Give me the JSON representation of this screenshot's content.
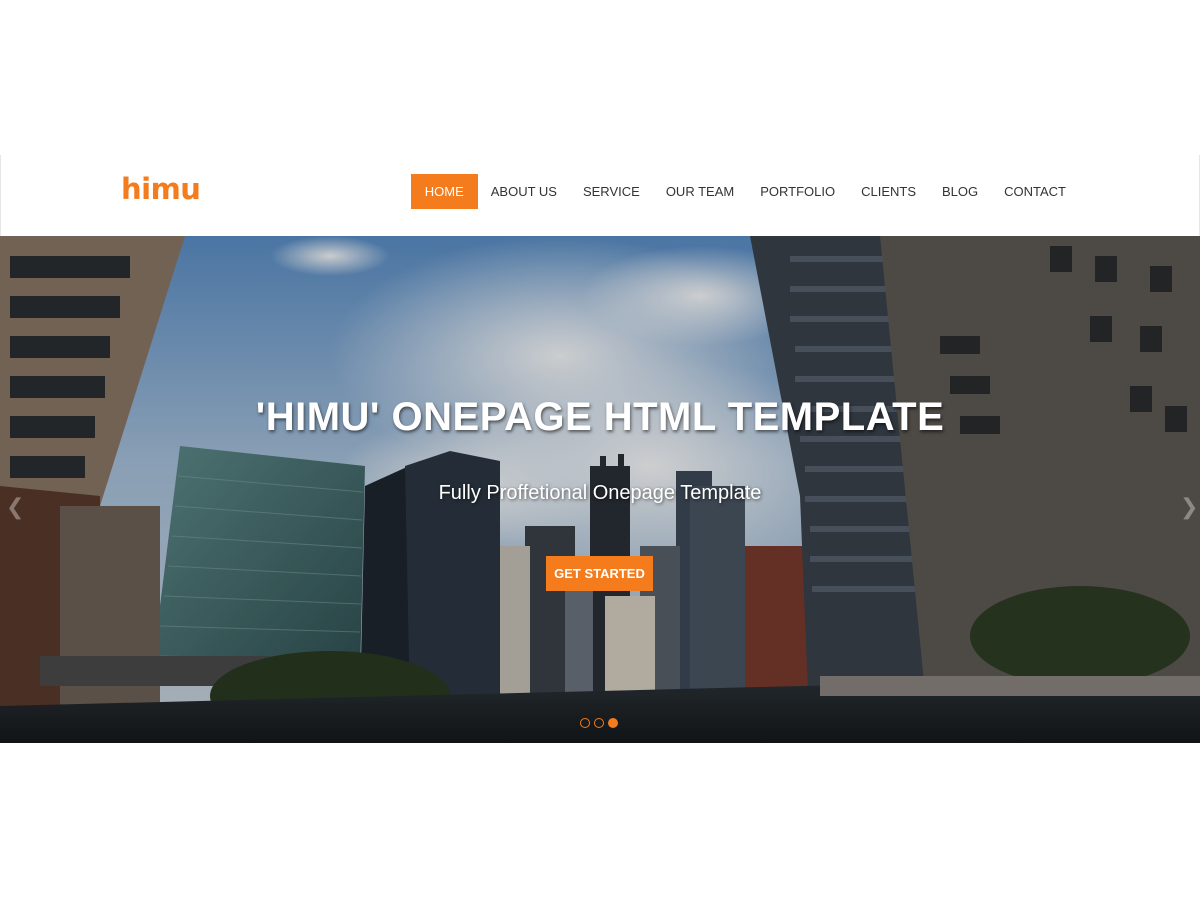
{
  "brand": {
    "logo_text": "himu",
    "accent_color": "#f47c1c"
  },
  "nav": {
    "items": [
      {
        "label": "HOME",
        "active": true
      },
      {
        "label": "ABOUT US"
      },
      {
        "label": "SERVICE"
      },
      {
        "label": "OUR TEAM"
      },
      {
        "label": "PORTFOLIO"
      },
      {
        "label": "CLIENTS"
      },
      {
        "label": "BLOG"
      },
      {
        "label": "CONTACT"
      }
    ]
  },
  "hero": {
    "title": "'HIMU' ONEPAGE HTML TEMPLATE",
    "subtitle": "Fully Proffetional Onepage Template",
    "button_label": "GET STARTED",
    "slide_count": 3,
    "active_slide": 3,
    "prev_icon": "chevron-left-icon",
    "next_icon": "chevron-right-icon"
  }
}
